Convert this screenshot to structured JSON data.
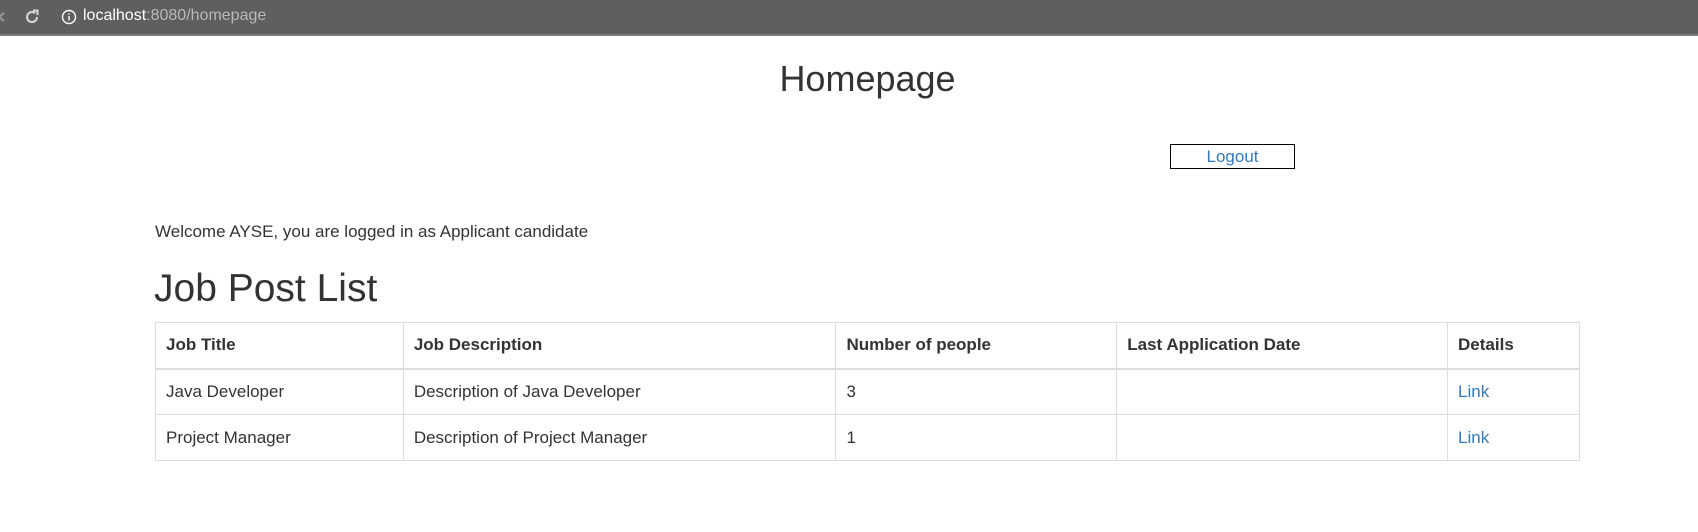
{
  "browser": {
    "url_host": "localhost",
    "url_path": ":8080/homepage"
  },
  "page": {
    "title": "Homepage",
    "logout_label": "Logout",
    "welcome": "Welcome AYSE, you are logged in as Applicant candidate",
    "section_title": "Job Post List"
  },
  "table": {
    "headers": [
      "Job Title",
      "Job Description",
      "Number of people",
      "Last Application Date",
      "Details"
    ],
    "rows": [
      {
        "title": "Java Developer",
        "description": "Description of Java Developer",
        "people": "3",
        "last_date": "",
        "details": "Link"
      },
      {
        "title": "Project Manager",
        "description": "Description of Project Manager",
        "people": "1",
        "last_date": "",
        "details": "Link"
      }
    ]
  },
  "colors": {
    "link": "#337ab7",
    "text": "#333333",
    "chrome": "#5f5f5f",
    "border": "#dddddd"
  },
  "icons": [
    "back-arrow-icon",
    "reload-icon",
    "info-icon"
  ]
}
